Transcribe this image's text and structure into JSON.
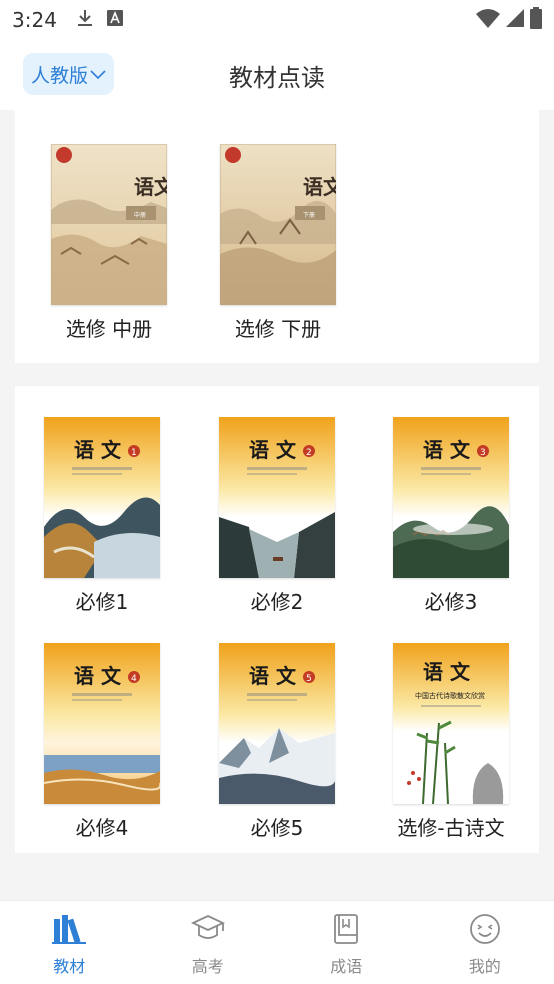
{
  "status_bar": {
    "time": "3:24"
  },
  "header": {
    "edition": "人教版",
    "title": "教材点读"
  },
  "sections": [
    {
      "books": [
        {
          "label": "选修 中册",
          "icon": "book-cover-elective-middle"
        },
        {
          "label": "选修 下册",
          "icon": "book-cover-elective-lower"
        }
      ]
    },
    {
      "books": [
        {
          "label": "必修1",
          "icon": "book-cover-compulsory-1"
        },
        {
          "label": "必修2",
          "icon": "book-cover-compulsory-2"
        },
        {
          "label": "必修3",
          "icon": "book-cover-compulsory-3"
        },
        {
          "label": "必修4",
          "icon": "book-cover-compulsory-4"
        },
        {
          "label": "必修5",
          "icon": "book-cover-compulsory-5"
        },
        {
          "label": "选修-古诗文",
          "icon": "book-cover-elective-poetry"
        }
      ]
    }
  ],
  "covers": {
    "old_title": "语文",
    "old_vol_mid": "中册",
    "old_vol_low": "下册",
    "new_title": "语 文",
    "new_nums": [
      "1",
      "2",
      "3",
      "4",
      "5"
    ],
    "poetry_subtitle": "中国古代诗歌散文欣赏"
  },
  "nav": [
    {
      "label": "教材",
      "icon": "books-icon",
      "active": true
    },
    {
      "label": "高考",
      "icon": "graduation-cap-icon",
      "active": false
    },
    {
      "label": "成语",
      "icon": "book-icon",
      "active": false
    },
    {
      "label": "我的",
      "icon": "smiley-face-icon",
      "active": false
    }
  ],
  "colors": {
    "accent": "#2e7fd6",
    "accent_bg": "#e3f2fd"
  }
}
